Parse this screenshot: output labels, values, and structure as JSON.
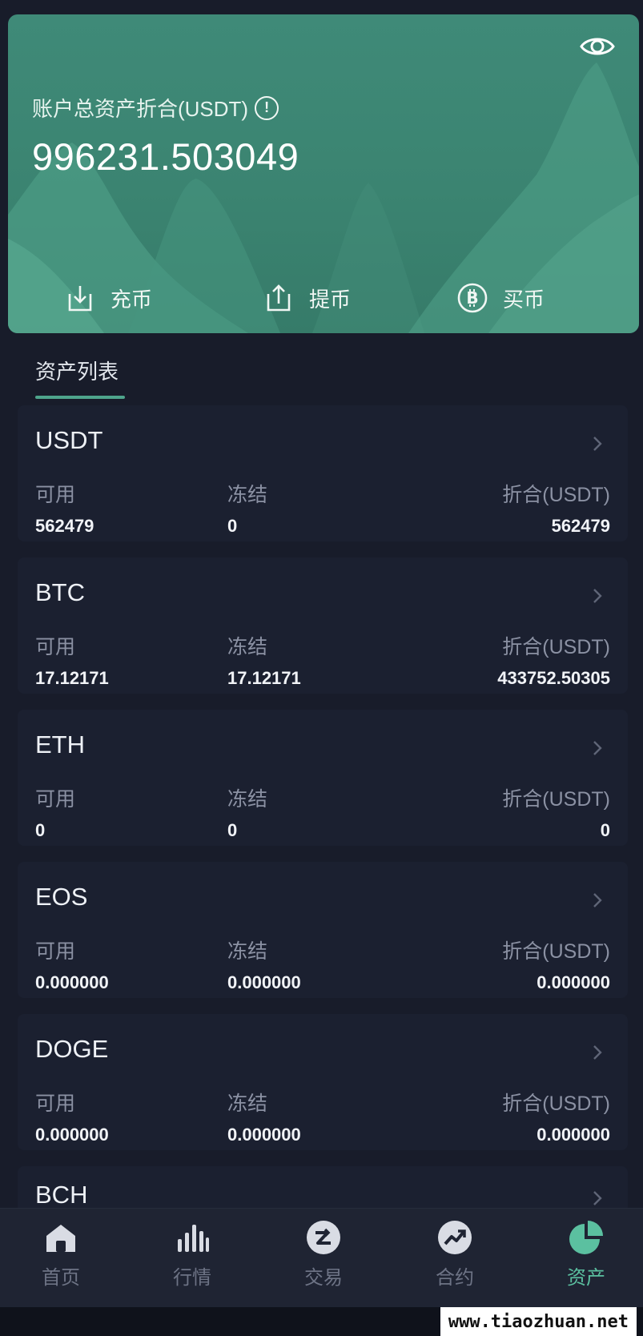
{
  "hero": {
    "total_label": "账户总资产折合(USDT)",
    "info_symbol": "!",
    "total_value": "996231.503049",
    "actions": [
      {
        "label": "充币",
        "icon": "download-icon"
      },
      {
        "label": "提币",
        "icon": "upload-icon"
      },
      {
        "label": "买币",
        "icon": "bitcoin-icon"
      }
    ]
  },
  "list": {
    "tab_label": "资产列表"
  },
  "assets": [
    {
      "symbol": "USDT",
      "available_label": "可用",
      "frozen_label": "冻结",
      "converted_label": "折合(USDT)",
      "available": "562479",
      "frozen": "0",
      "converted": "562479"
    },
    {
      "symbol": "BTC",
      "available_label": "可用",
      "frozen_label": "冻结",
      "converted_label": "折合(USDT)",
      "available": "17.12171",
      "frozen": "17.12171",
      "converted": "433752.50305"
    },
    {
      "symbol": "ETH",
      "available_label": "可用",
      "frozen_label": "冻结",
      "converted_label": "折合(USDT)",
      "available": "0",
      "frozen": "0",
      "converted": "0"
    },
    {
      "symbol": "EOS",
      "available_label": "可用",
      "frozen_label": "冻结",
      "converted_label": "折合(USDT)",
      "available": "0.000000",
      "frozen": "0.000000",
      "converted": "0.000000"
    },
    {
      "symbol": "DOGE",
      "available_label": "可用",
      "frozen_label": "冻结",
      "converted_label": "折合(USDT)",
      "available": "0.000000",
      "frozen": "0.000000",
      "converted": "0.000000"
    },
    {
      "symbol": "BCH"
    }
  ],
  "nav": {
    "items": [
      {
        "label": "首页",
        "icon": "home-icon"
      },
      {
        "label": "行情",
        "icon": "market-bars-icon"
      },
      {
        "label": "交易",
        "icon": "exchange-icon"
      },
      {
        "label": "合约",
        "icon": "trend-up-icon"
      },
      {
        "label": "资产",
        "icon": "pie-chart-icon"
      }
    ],
    "active_index": 4
  },
  "watermark": "www.tiaozhuan.net",
  "colors": {
    "background": "#181c2a",
    "hero": "#3f8a78",
    "accent": "#5bc0a0",
    "label_gray": "#8b91a3",
    "nav_inactive": "#6d7385"
  }
}
